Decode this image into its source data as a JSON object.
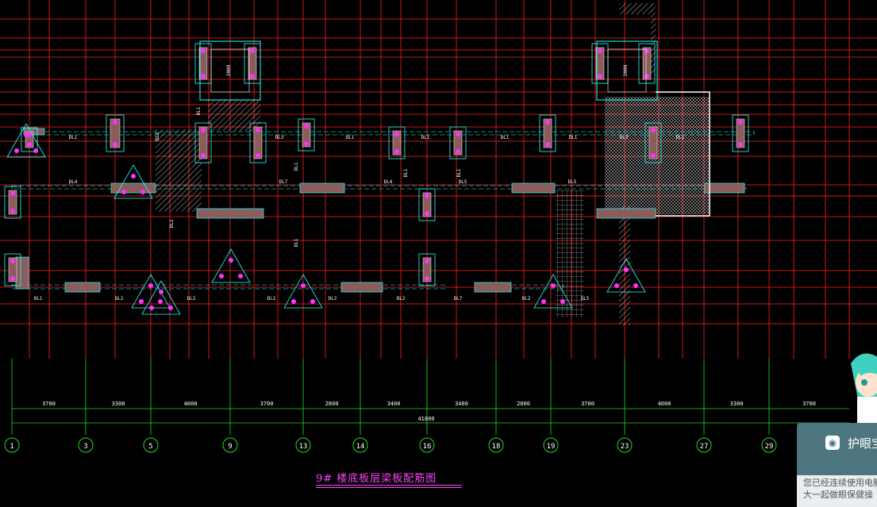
{
  "drawing": {
    "title": "9# 楼底板层梁板配筋图",
    "overall_dimension": "41800",
    "span_dimensions": [
      "3700",
      "3300",
      "4000",
      "3700",
      "2800",
      "3400",
      "3400",
      "2800",
      "3700",
      "4000",
      "3300",
      "3700"
    ],
    "axis_labels": [
      "1",
      "3",
      "5",
      "9",
      "13",
      "14",
      "16",
      "18",
      "19",
      "23",
      "27",
      "29"
    ],
    "beam_labels_top_row": [
      "DL1",
      "DL3",
      "DL1",
      "DL1",
      "DL1",
      "DL1",
      "DL3",
      "DL1"
    ],
    "beam_labels_middle_row": [
      "DL4",
      "DL7",
      "DL4",
      "DL5",
      "DL5"
    ],
    "beam_labels_bottom_row": [
      "DL1",
      "DL2",
      "DL2",
      "DL2",
      "DL2",
      "DL2",
      "DL7",
      "DL2",
      "DL5"
    ],
    "beam_labels_misc": [
      "DL3",
      "DL2",
      "DL1",
      "DL1",
      "DL1",
      "DL1",
      "DL1"
    ],
    "slab_dimension": "2000",
    "colors": {
      "background": "#000000",
      "grid_red": "#ff2020",
      "grid_green": "#22dd22",
      "column_cyan": "#22ffff",
      "hatch_white": "#e0e0e0",
      "beam_fill": "#8a5c5c",
      "marker_magenta": "#ff33ff",
      "title_magenta": "#ff44ff"
    }
  },
  "overlay": {
    "title": "护眼宝",
    "icon": "eye-care-icon",
    "body_text": "您已经连续使用电脑\n大一起做眼保健操"
  }
}
